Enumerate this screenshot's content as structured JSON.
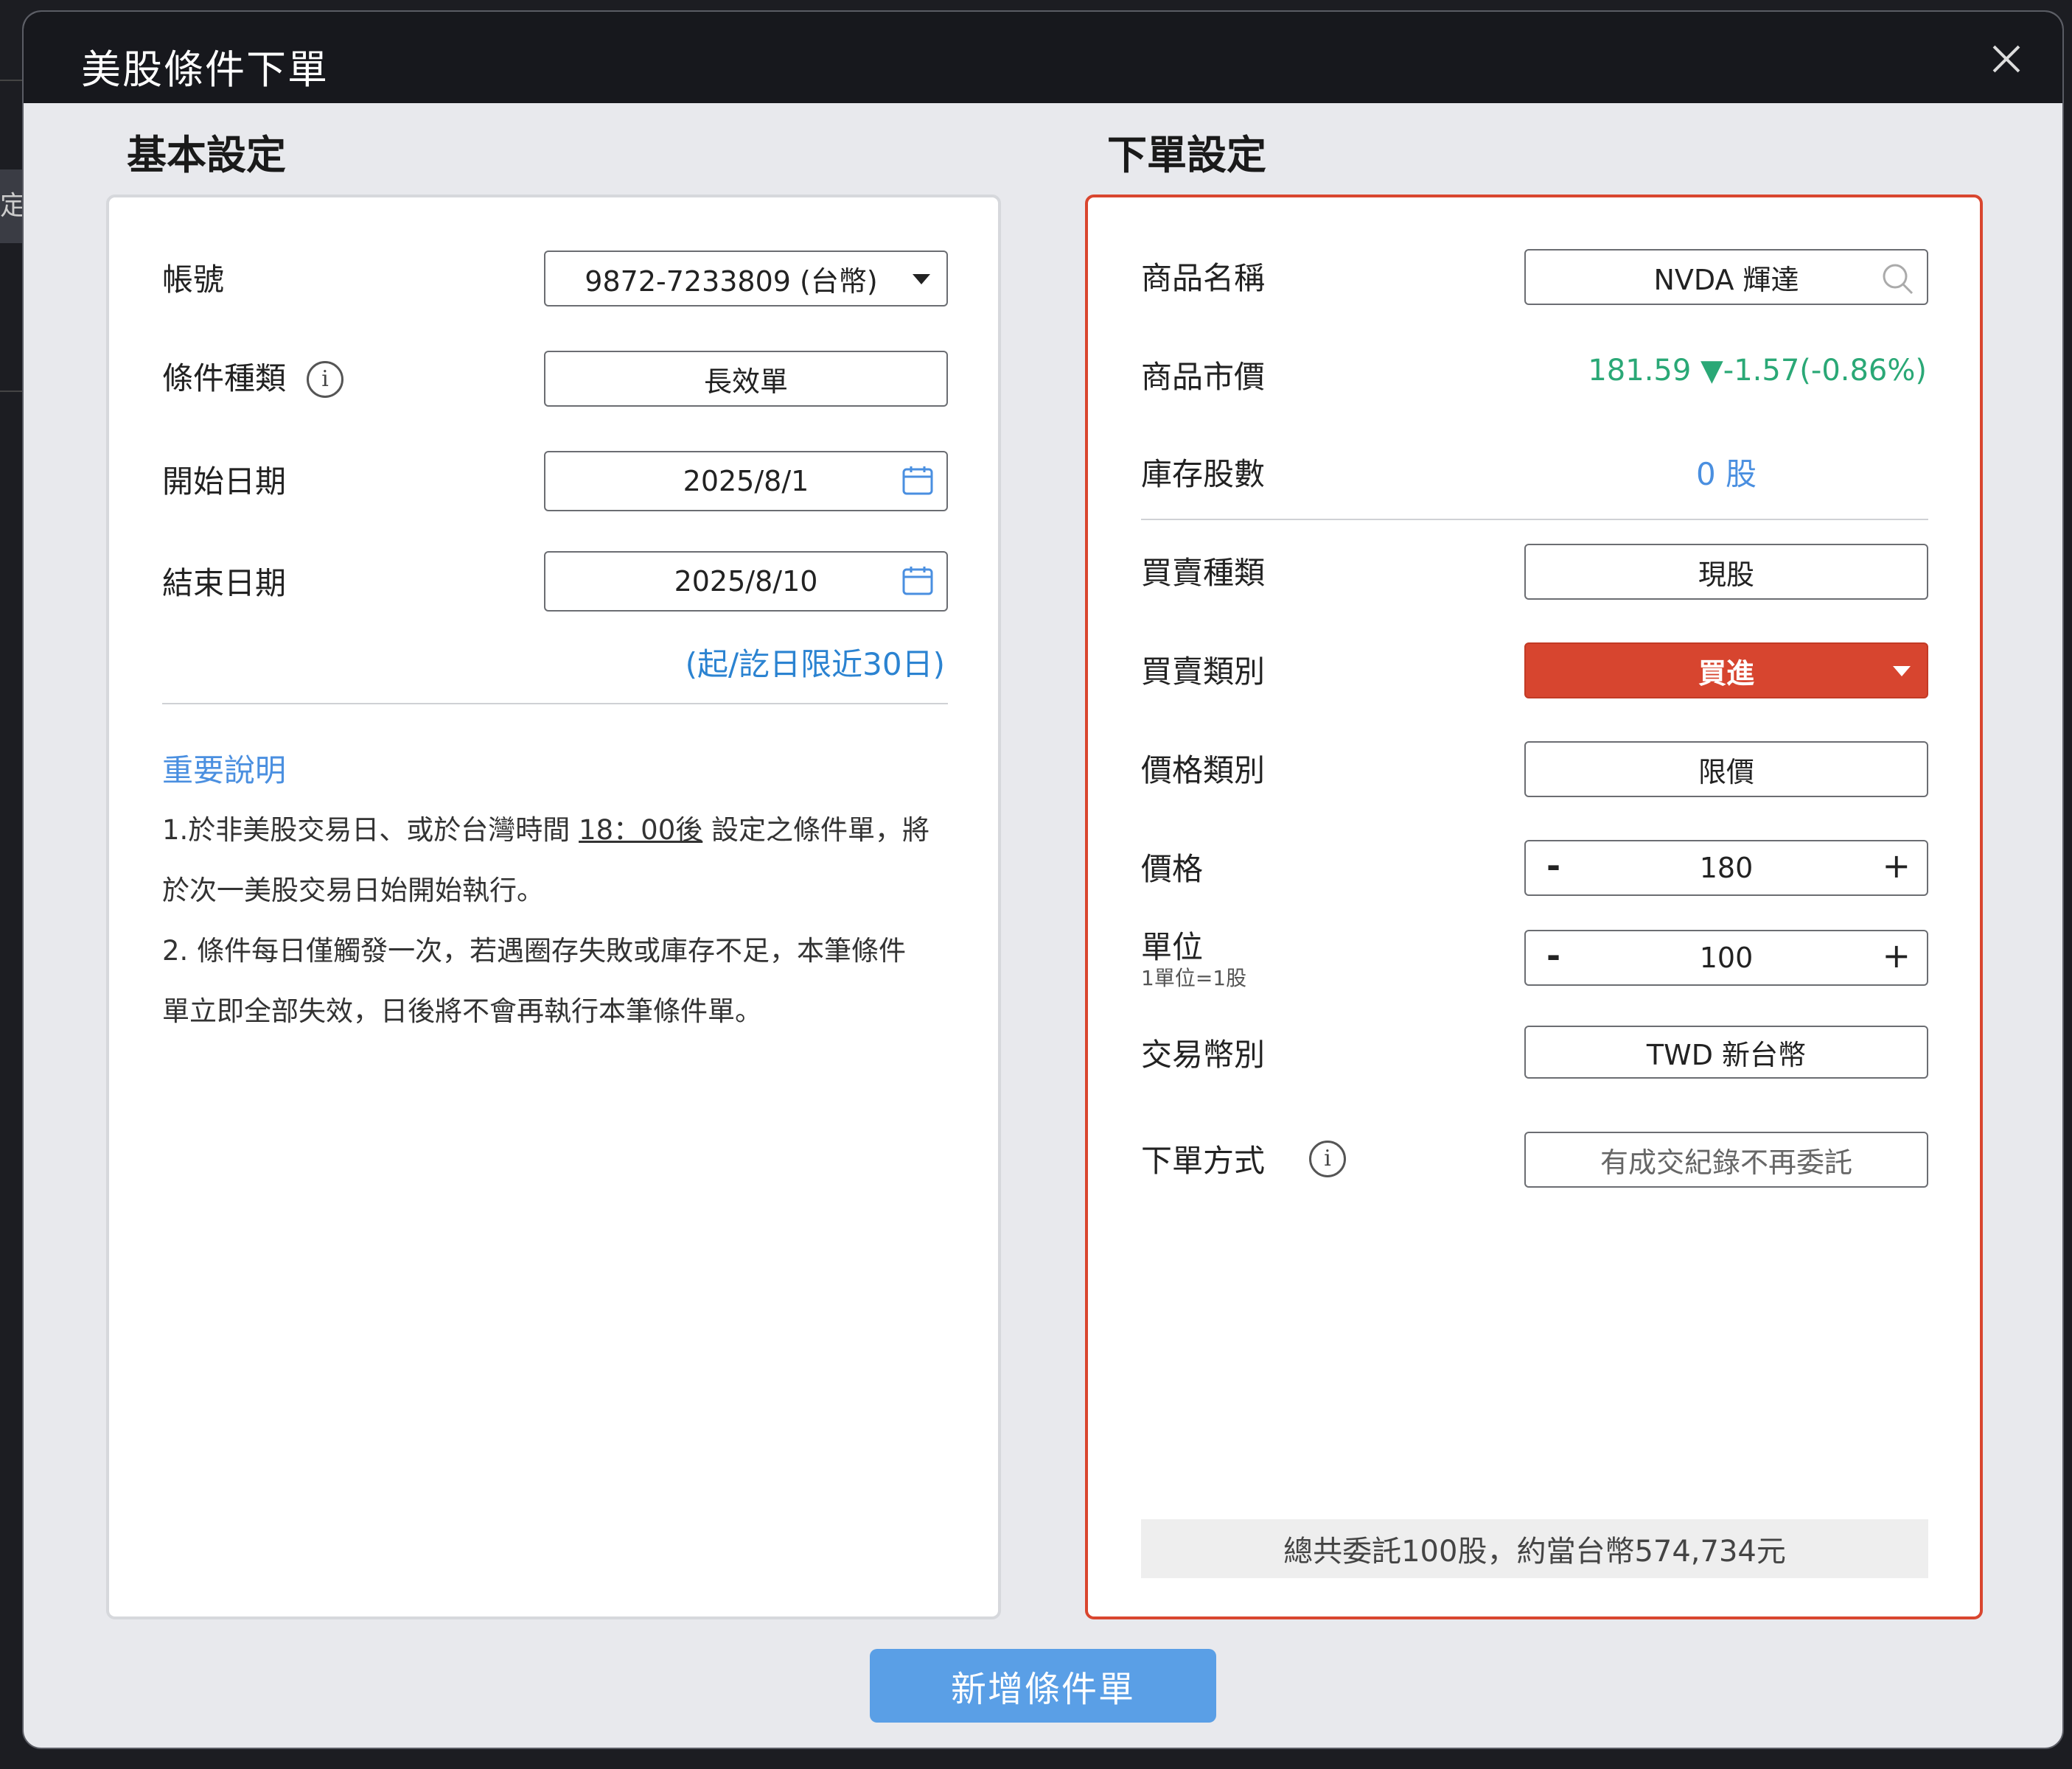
{
  "background": {
    "left_tab_text": "定"
  },
  "dialog": {
    "title": "美股條件下單",
    "submit_label": "新增條件單"
  },
  "basic": {
    "section_title": "基本設定",
    "account_label": "帳號",
    "account_value": "9872-7233809 (台幣)",
    "condition_type_label": "條件種類",
    "condition_type_value": "長效單",
    "start_date_label": "開始日期",
    "start_date_value": "2025/8/1",
    "end_date_label": "結束日期",
    "end_date_value": "2025/8/10",
    "date_hint": "(起/訖日限近30日)",
    "important_link": "重要說明",
    "note1_a": "1.於非美股交易日、或於台灣時間",
    "note1_time": "18：00後",
    "note1_b": "設定之條件單，將",
    "note1_c": "於次一美股交易日始開始執行。",
    "note2_a": "2. 條件每日僅觸發一次，若遇圈存失敗或庫存不足，本筆條件",
    "note2_b": "單立即全部失效，日後將不會再執行本筆條件單。"
  },
  "order": {
    "section_title": "下單設定",
    "product_label": "商品名稱",
    "product_value": "NVDA 輝達",
    "market_price_label": "商品市價",
    "market_price_value": "181.59 ▼-1.57(-0.86%)",
    "inventory_label": "庫存股數",
    "inventory_value": "0 股",
    "trade_type_label": "買賣種類",
    "trade_type_value": "現股",
    "side_label": "買賣類別",
    "side_value": "買進",
    "price_type_label": "價格類別",
    "price_type_value": "限價",
    "price_label": "價格",
    "price_value": "180",
    "unit_label": "單位",
    "unit_sub_label": "1單位=1股",
    "unit_value": "100",
    "currency_label": "交易幣別",
    "currency_value": "TWD 新台幣",
    "method_label": "下單方式",
    "method_value": "有成交紀錄不再委託",
    "summary": "總共委託100股，約當台幣574,734元"
  },
  "icons": {
    "close": "close-icon",
    "calendar": "calendar-icon",
    "info": "info-icon",
    "search": "search-icon",
    "dropdown": "chevron-down-icon"
  },
  "colors": {
    "accent_red": "#d7452f",
    "price_green": "#2aa876",
    "link_blue": "#4a8fe0",
    "submit_blue": "#5a9fe6"
  }
}
